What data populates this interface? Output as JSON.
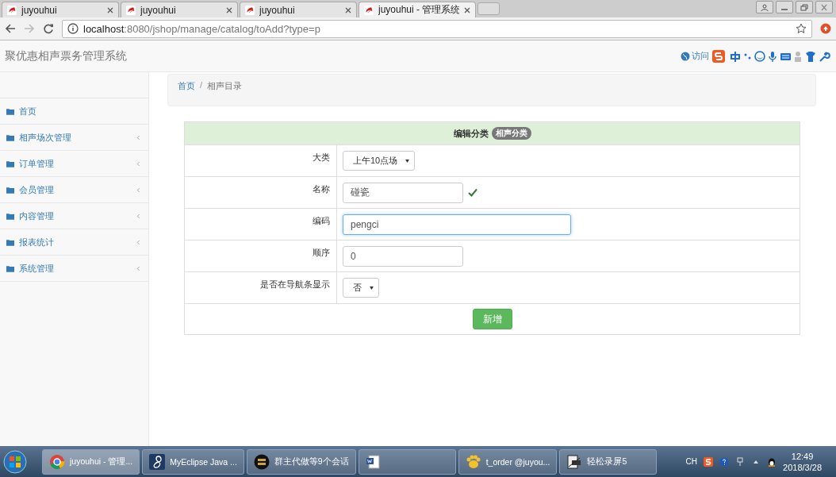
{
  "browser": {
    "tabs": [
      {
        "title": "juyouhui",
        "selected": false
      },
      {
        "title": "juyouhui",
        "selected": false
      },
      {
        "title": "juyouhui",
        "selected": false
      },
      {
        "title": "juyouhui - 管理系统",
        "selected": true
      }
    ],
    "url": {
      "host": "localhost",
      "rest": ":8080/jshop/manage/catalog/toAdd?type=p"
    }
  },
  "app": {
    "title": "聚优惠相声票务管理系统",
    "visit_link": "访问"
  },
  "sidebar": {
    "items": [
      {
        "label": "首页",
        "has_submenu": false
      },
      {
        "label": "相声场次管理",
        "has_submenu": true
      },
      {
        "label": "订单管理",
        "has_submenu": true
      },
      {
        "label": "会员管理",
        "has_submenu": true
      },
      {
        "label": "内容管理",
        "has_submenu": true
      },
      {
        "label": "报表统计",
        "has_submenu": true
      },
      {
        "label": "系统管理",
        "has_submenu": true
      }
    ]
  },
  "breadcrumb": {
    "separator": "/",
    "items": [
      {
        "label": "首页",
        "kind": "link"
      },
      {
        "label": "相声目录",
        "kind": "current"
      }
    ]
  },
  "form": {
    "title": "编辑分类",
    "badge": "相声分类",
    "rows": [
      {
        "label": "大类",
        "kind": "select",
        "value": "上午10点场",
        "focused": false,
        "valid": false
      },
      {
        "label": "名称",
        "kind": "input",
        "value": "碰瓷",
        "focused": false,
        "valid": true
      },
      {
        "label": "编码",
        "kind": "input",
        "value": "pengci",
        "focused": true,
        "valid": false
      },
      {
        "label": "顺序",
        "kind": "input",
        "value": "0",
        "focused": false,
        "valid": false
      },
      {
        "label": "是否在导航条显示",
        "kind": "select",
        "value": "否",
        "focused": false,
        "valid": false
      }
    ],
    "submit": "新增"
  },
  "taskbar": {
    "items": [
      {
        "label": "juyouhui - 管理...",
        "kind": "browser",
        "selected": true
      },
      {
        "label": "MyEclipse Java ...",
        "kind": "ide",
        "selected": false
      },
      {
        "label": "群主代做等9个会话",
        "kind": "chat",
        "selected": false
      },
      {
        "kind": "document",
        "selected": false
      },
      {
        "label": "t_order @juyou...",
        "kind": "database",
        "selected": false
      },
      {
        "label": "轻松录屏5",
        "kind": "recorder",
        "selected": false
      }
    ],
    "tray": {
      "language": "CH",
      "time": "12:49",
      "date": "2018/3/28"
    }
  }
}
